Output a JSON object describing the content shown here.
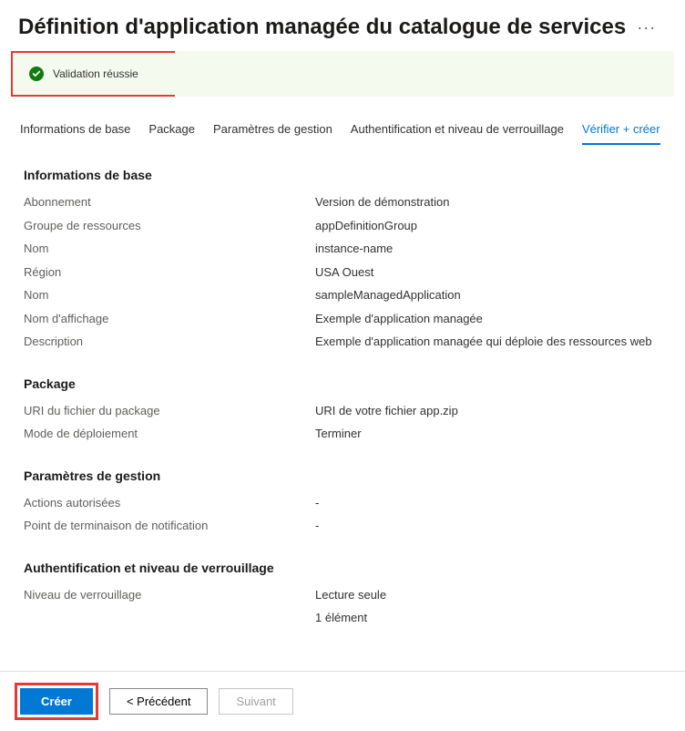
{
  "header": {
    "title": "Définition d'application managée du catalogue de services",
    "more_icon": "···"
  },
  "validation": {
    "message": "Validation réussie"
  },
  "tabs": [
    {
      "label": "Informations de base",
      "active": false
    },
    {
      "label": "Package",
      "active": false
    },
    {
      "label": "Paramètres de gestion",
      "active": false
    },
    {
      "label": "Authentification et niveau de verrouillage",
      "active": false
    },
    {
      "label": "Vérifier + créer",
      "active": true
    }
  ],
  "sections": {
    "basics": {
      "title": "Informations de base",
      "rows": [
        {
          "label": "Abonnement",
          "value": "Version de démonstration"
        },
        {
          "label": "Groupe de ressources",
          "value": "appDefinitionGroup"
        },
        {
          "label": "Nom",
          "value": "instance-name"
        },
        {
          "label": "Région",
          "value": "USA Ouest"
        },
        {
          "label": "Nom",
          "value": "sampleManagedApplication"
        },
        {
          "label": "Nom d'affichage",
          "value": "Exemple d'application managée"
        },
        {
          "label": "Description",
          "value": "Exemple d'application managée qui déploie des ressources web"
        }
      ]
    },
    "package": {
      "title": "Package",
      "rows": [
        {
          "label": "URI du fichier du package",
          "value": "URI de votre fichier app.zip"
        },
        {
          "label": "Mode de déploiement",
          "value": "Terminer"
        }
      ]
    },
    "mgmt": {
      "title": "Paramètres de gestion",
      "rows": [
        {
          "label": "Actions autorisées",
          "value": "-"
        },
        {
          "label": "Point de terminaison de notification",
          "value": "-"
        }
      ]
    },
    "auth": {
      "title": "Authentification et niveau de verrouillage",
      "rows": [
        {
          "label": "Niveau de verrouillage",
          "value": "Lecture seule"
        },
        {
          "label": "",
          "value": "1 élément"
        }
      ]
    }
  },
  "footer": {
    "create": "Créer",
    "previous": "< Précédent",
    "next": "Suivant"
  }
}
